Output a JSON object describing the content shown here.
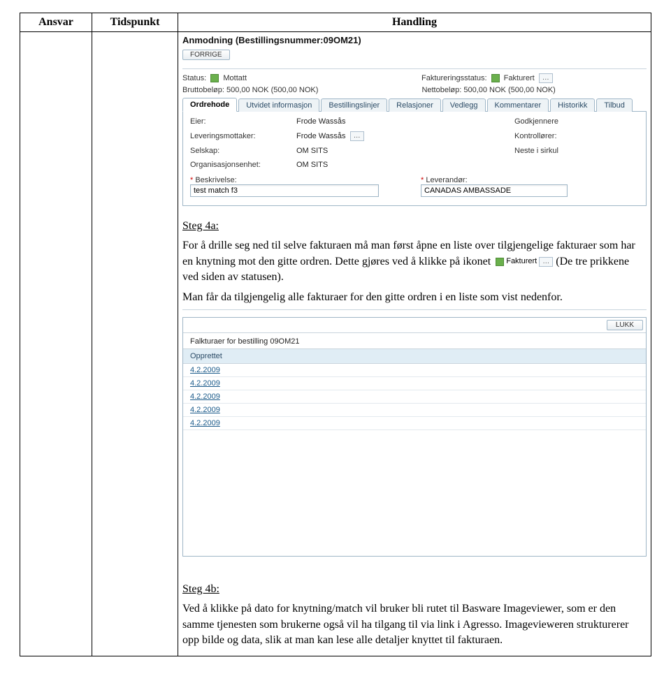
{
  "columns": {
    "ansvar": "Ansvar",
    "tidspunkt": "Tidspunkt",
    "handling": "Handling"
  },
  "screenshot1": {
    "heading": "Anmodning (Bestillingsnummer:09OM21)",
    "back_button": "FORRIGE",
    "status_label": "Status:",
    "status_value": "Mottatt",
    "invoice_status_label": "Faktureringsstatus:",
    "invoice_status_value": "Fakturert",
    "brutto_label": "Bruttobeløp: 500,00 NOK (500,00 NOK)",
    "netto_label": "Nettobeløp: 500,00 NOK (500,00 NOK)",
    "tabs": [
      "Ordrehode",
      "Utvidet informasjon",
      "Bestillingslinjer",
      "Relasjoner",
      "Vedlegg",
      "Kommentarer",
      "Historikk",
      "Tilbud"
    ],
    "fields": {
      "eier_label": "Eier:",
      "eier_value": "Frode Wassås",
      "godkjennere_label": "Godkjennere",
      "lev_label": "Leveringsmottaker:",
      "lev_value": "Frode Wassås",
      "kontrollorer_label": "Kontrollører:",
      "selskap_label": "Selskap:",
      "selskap_value": "OM SITS",
      "neste_label": "Neste i sirkul",
      "org_label": "Organisasjonsenhet:",
      "org_value": "OM SITS",
      "beskrivelse_label": "Beskrivelse:",
      "beskrivelse_value": "test match f3",
      "leverandor_label": "Leverandør:",
      "leverandor_value": "CANADAS AMBASSADE"
    }
  },
  "step4a": {
    "heading": "Steg 4a:",
    "p1_a": "For å drille seg ned til selve fakturaen må man først åpne en liste over tilgjengelige fakturaer som har en knytning mot den gitte ordren. Dette gjøres ved å klikke på ikonet ",
    "p1_b": " (De tre prikkene ved siden av statusen).",
    "inline_status_value": "Fakturert",
    "p2": "Man får da tilgjengelig alle fakturaer for den gitte ordren i en liste som vist nedenfor."
  },
  "screenshot2": {
    "close_label": "LUKK",
    "title": "Falkturaer for bestilling 09OM21",
    "header": "Opprettet",
    "rows": [
      "4.2.2009",
      "4.2.2009",
      "4.2.2009",
      "4.2.2009",
      "4.2.2009"
    ]
  },
  "step4b": {
    "heading": "Steg 4b:",
    "p1": "Ved å klikke på dato for knytning/match vil bruker bli rutet til Basware Imageviewer, som er den samme tjenesten som brukerne også vil ha tilgang til via link i Agresso. Imagevieweren strukturerer opp bilde og data, slik at man kan lese alle detaljer knyttet til fakturaen."
  }
}
